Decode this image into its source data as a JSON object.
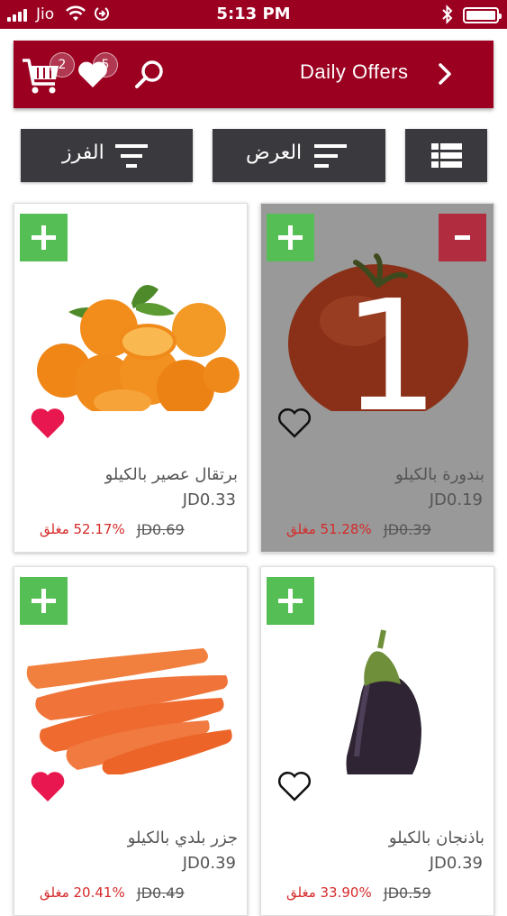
{
  "status_bar": {
    "carrier": "Jio",
    "time": "5:13 PM"
  },
  "header": {
    "cart_count": "2",
    "favorites_count": "5",
    "offers_label": "Daily Offers"
  },
  "toolbar": {
    "sort_label": "الفرز",
    "display_label": "العرض"
  },
  "products": [
    {
      "name": "برتقال عصير بالكيلو",
      "price": "JD0.33",
      "old_price": "JD0.69",
      "discount": "52.17% مغلق",
      "favorited": true,
      "selected": false
    },
    {
      "name": "بندورة بالكيلو",
      "price": "JD0.19",
      "old_price": "JD0.39",
      "discount": "51.28% مغلق",
      "favorited": false,
      "selected": true,
      "quantity": "1"
    },
    {
      "name": "جزر بلدي بالكيلو",
      "price": "JD0.39",
      "old_price": "JD0.49",
      "discount": "20.41% مغلق",
      "favorited": true,
      "selected": false
    },
    {
      "name": "باذنجان بالكيلو",
      "price": "JD0.39",
      "old_price": "JD0.59",
      "discount": "33.90% مغلق",
      "favorited": false,
      "selected": false
    }
  ],
  "colors": {
    "brand": "#9b0021",
    "add": "#55bf55",
    "remove": "#b12c3f",
    "favorite": "#e8174f",
    "discount": "#d62a2a",
    "button_bg": "#3a3a3e"
  }
}
